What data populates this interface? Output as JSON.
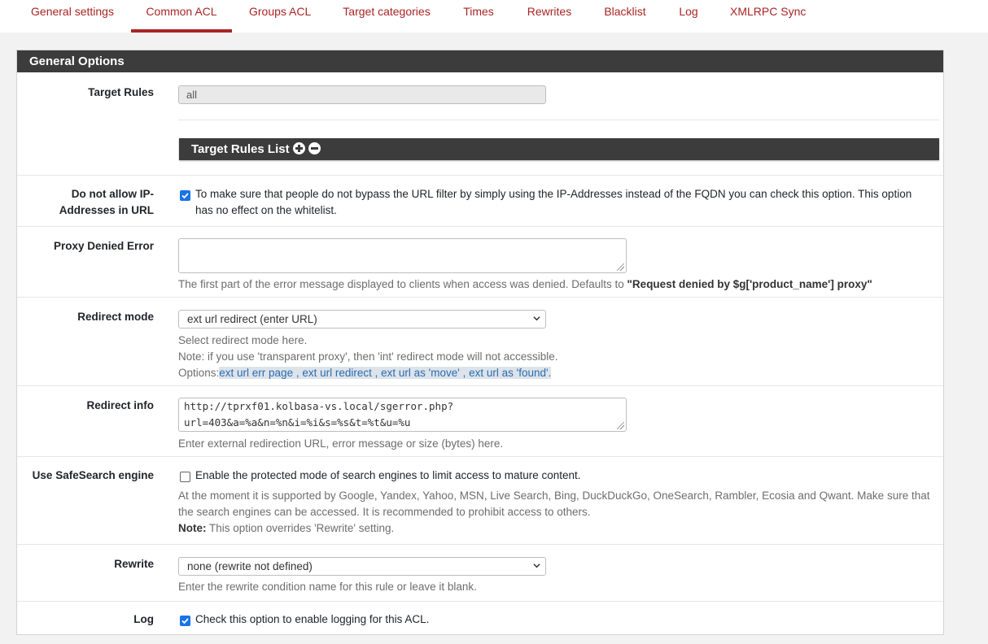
{
  "tabs": [
    {
      "label": "General settings"
    },
    {
      "label": "Common ACL"
    },
    {
      "label": "Groups ACL"
    },
    {
      "label": "Target categories"
    },
    {
      "label": "Times"
    },
    {
      "label": "Rewrites"
    },
    {
      "label": "Blacklist"
    },
    {
      "label": "Log"
    },
    {
      "label": "XMLRPC Sync"
    }
  ],
  "active_tab": "Common ACL",
  "panel": {
    "title": "General Options"
  },
  "target_rules": {
    "label": "Target Rules",
    "value": "all",
    "list_title": "Target Rules List"
  },
  "ip_block": {
    "label_line1": "Do not allow IP-",
    "label_line2": "Addresses in URL",
    "checked": true,
    "text_line1": "To make sure that people do not bypass the URL filter by simply using the IP-Addresses instead of the FQDN you can check this option. This option",
    "text_line2": "has no effect on the whitelist."
  },
  "proxy_denied": {
    "label": "Proxy Denied Error",
    "value": "",
    "help_prefix": "The first part of the error message displayed to clients when access was denied. Defaults to ",
    "help_default": "\"Request denied by $g['product_name'] proxy\""
  },
  "redirect_mode": {
    "label": "Redirect mode",
    "selected": "ext url redirect (enter URL)",
    "help1": "Select redirect mode here.",
    "help2": "Note: if you use 'transparent proxy', then 'int' redirect mode will not accessible.",
    "options_prefix": "Options:",
    "options": [
      "ext url err page",
      "ext url redirect",
      "ext url as 'move'",
      "ext url as 'found'."
    ],
    "separator": " , "
  },
  "redirect_info": {
    "label": "Redirect info",
    "value_line1": "http://tprxf01.kolbasa-vs.local/sgerror.php?",
    "value_line2": "url=403&a=%a&n=%n&i=%i&s=%s&t=%t&u=%u",
    "help": "Enter external redirection URL, error message or size (bytes) here."
  },
  "safesearch": {
    "label": "Use SafeSearch engine",
    "checked": false,
    "text": "Enable the protected mode of search engines to limit access to mature content.",
    "help1": "At the moment it is supported by Google, Yandex, Yahoo, MSN, Live Search, Bing, DuckDuckGo, OneSearch, Rambler, Ecosia and Qwant. Make sure that",
    "help2": "the search engines can be accessed. It is recommended to prohibit access to others.",
    "note_label": "Note:",
    "note_text": " This option overrides 'Rewrite' setting."
  },
  "rewrite": {
    "label": "Rewrite",
    "selected": "none (rewrite not defined)",
    "help": "Enter the rewrite condition name for this rule or leave it blank."
  },
  "log": {
    "label": "Log",
    "checked": true,
    "text": "Check this option to enable logging for this ACL."
  },
  "icons": {
    "add": "plus-circle-icon",
    "remove": "minus-circle-icon",
    "checkbox": "checkbox-icon",
    "dropdown": "chevron-down-icon",
    "resize": "resize-grip-icon"
  },
  "colors": {
    "accent": "#a92424",
    "header_bg": "#3c3c3c",
    "checkbox": "#1a73e8",
    "link": "#2a6db0"
  }
}
